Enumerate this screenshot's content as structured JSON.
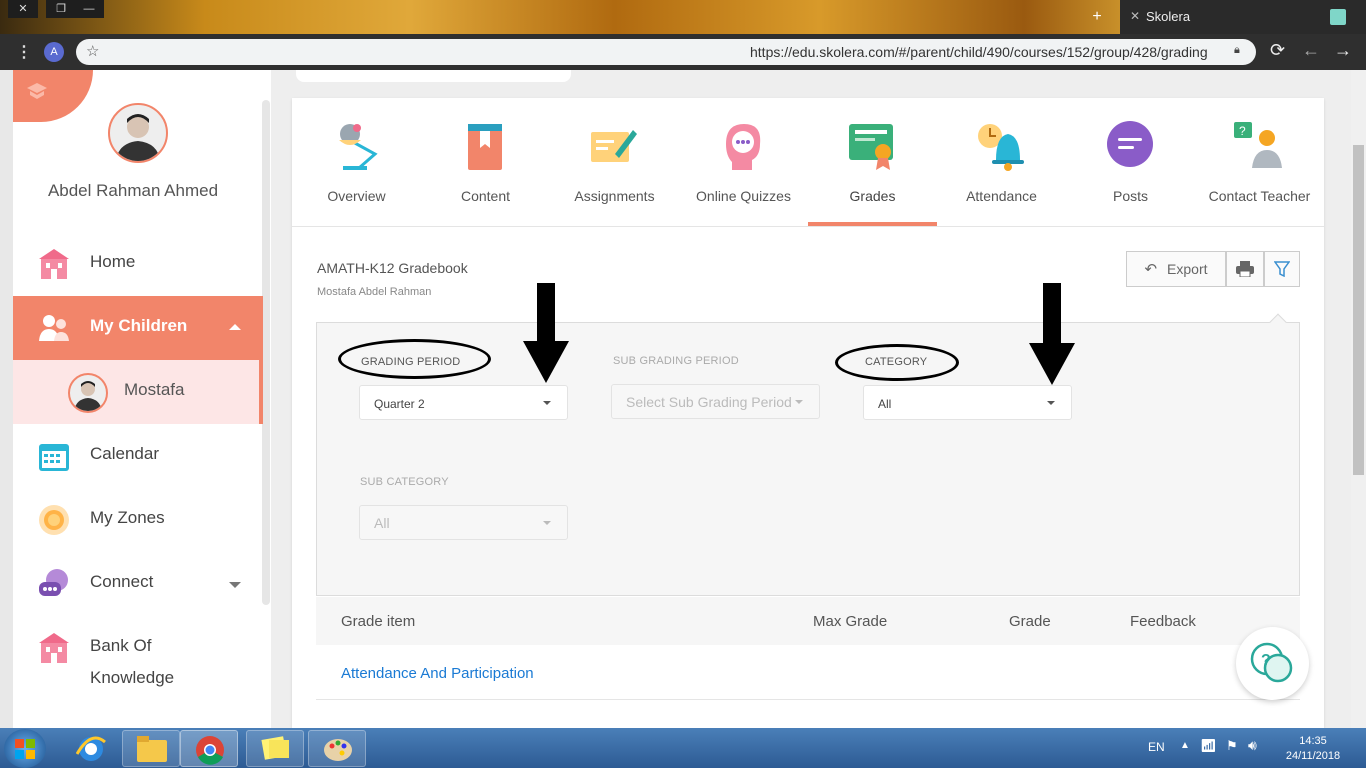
{
  "browser": {
    "tab_title": "Skolera",
    "url": "https://edu.skolera.com/#/parent/child/490/courses/152/group/428/grading",
    "profile_letter": "A"
  },
  "sidebar": {
    "user_name": "Abdel Rahman Ahmed",
    "items": [
      {
        "label": "Home",
        "icon": "school-icon"
      },
      {
        "label": "My Children",
        "icon": "children-icon"
      },
      {
        "label": "Mostafa",
        "icon": "avatar"
      },
      {
        "label": "Calendar",
        "icon": "calendar-icon"
      },
      {
        "label": "My Zones",
        "icon": "zones-icon"
      },
      {
        "label": "Connect",
        "icon": "connect-icon"
      },
      {
        "label": "Bank Of",
        "label2": "Knowledge",
        "icon": "bank-icon"
      }
    ]
  },
  "tabs": [
    {
      "label": "Overview"
    },
    {
      "label": "Content"
    },
    {
      "label": "Assignments"
    },
    {
      "label": "Online Quizzes"
    },
    {
      "label": "Grades",
      "active": true
    },
    {
      "label": "Attendance"
    },
    {
      "label": "Posts"
    },
    {
      "label": "Contact Teacher"
    }
  ],
  "gradebook": {
    "title": "AMATH-K12 Gradebook",
    "student": "Mostafa Abdel Rahman",
    "export_label": "Export"
  },
  "filters": {
    "grading_period": {
      "label": "GRADING PERIOD",
      "value": "Quarter 2"
    },
    "sub_grading_period": {
      "label": "SUB GRADING PERIOD",
      "placeholder": "Select Sub Grading Period"
    },
    "category": {
      "label": "CATEGORY",
      "value": "All"
    },
    "sub_category": {
      "label": "SUB CATEGORY",
      "value": "All"
    }
  },
  "table": {
    "headers": [
      "Grade item",
      "Max Grade",
      "Grade",
      "Feedback"
    ],
    "rows": [
      {
        "item": "Attendance And Participation"
      }
    ]
  },
  "taskbar": {
    "lang": "EN",
    "time": "14:35",
    "date": "24/11/2018"
  },
  "colors": {
    "accent": "#f2856a",
    "link": "#1a7ad4"
  }
}
